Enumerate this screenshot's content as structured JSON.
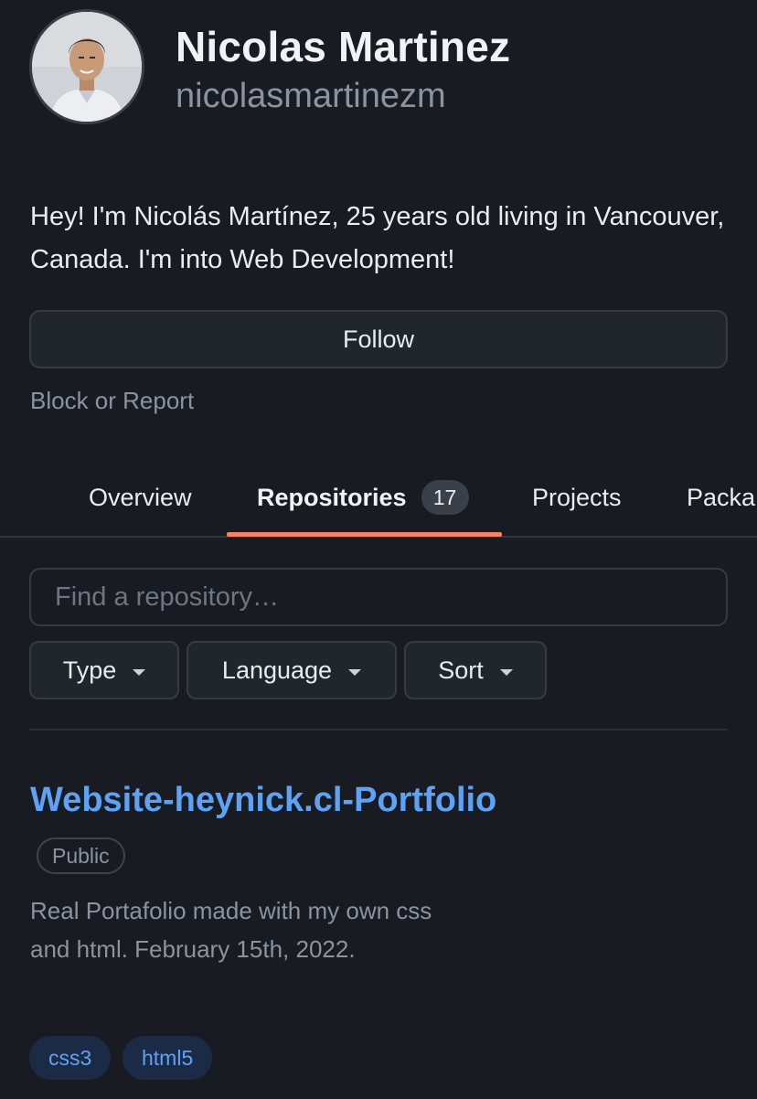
{
  "profile": {
    "full_name": "Nicolas Martinez",
    "username": "nicolasmartinezm",
    "bio": "Hey! I'm Nicolás Martínez, 25 years old living in Vancouver, Canada. I'm into Web Development!",
    "follow_label": "Follow",
    "block_label": "Block or Report"
  },
  "tabs": [
    {
      "label": "Overview"
    },
    {
      "label": "Repositories",
      "count": "17",
      "active": true
    },
    {
      "label": "Projects"
    },
    {
      "label": "Packa"
    }
  ],
  "search": {
    "placeholder": "Find a repository…"
  },
  "filters": [
    {
      "label": "Type"
    },
    {
      "label": "Language"
    },
    {
      "label": "Sort"
    }
  ],
  "repos": [
    {
      "name": "Website-heynick.cl-Portfolio",
      "visibility": "Public",
      "description": "Real Portafolio made with my own css and html. February 15th, 2022.",
      "topics": [
        "css3",
        "html5"
      ]
    }
  ],
  "colors": {
    "background": "#181b22",
    "link": "#5ea2f5",
    "tab_underline": "#f78166",
    "muted_text": "#8b949e",
    "topic_bg": "#1b2b45"
  }
}
